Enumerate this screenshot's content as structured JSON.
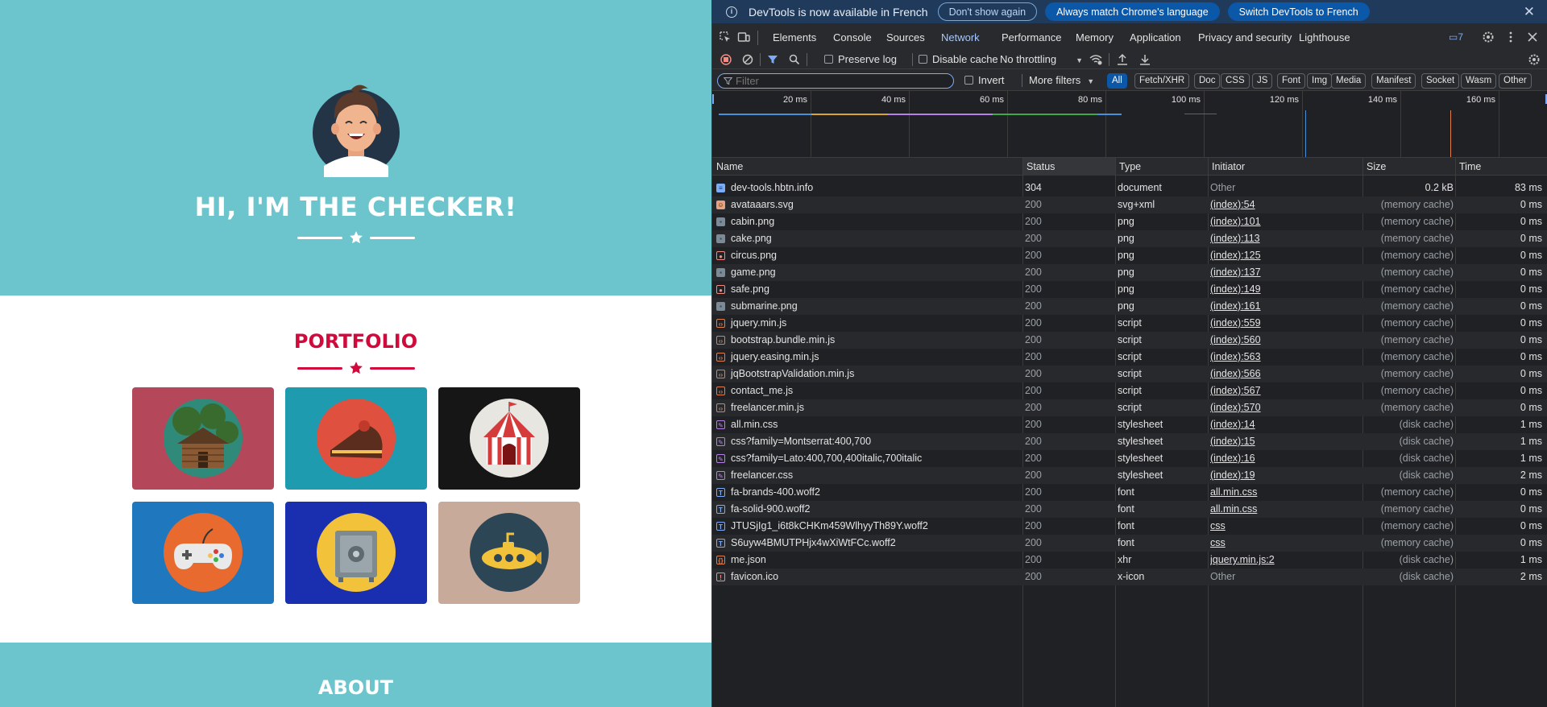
{
  "site": {
    "hero_title": "HI, I'M THE CHECKER!",
    "portfolio_title": "PORTFOLIO",
    "about_title": "ABOUT",
    "colors": {
      "primary": "#6cc5cc",
      "accent": "#d10a3c"
    },
    "portfolio_items": [
      {
        "name": "cabin",
        "bg": "#b5475b"
      },
      {
        "name": "cake",
        "bg": "#1f9bb0"
      },
      {
        "name": "circus",
        "bg": "#161616"
      },
      {
        "name": "game",
        "bg": "#1f77bd"
      },
      {
        "name": "safe",
        "bg": "#1a2fb0"
      },
      {
        "name": "submarine",
        "bg": "#c8aa9b"
      }
    ]
  },
  "devtools": {
    "infobar": {
      "text": "DevTools is now available in French",
      "dont_show": "Don't show again",
      "match_lang": "Always match Chrome's language",
      "switch_lang": "Switch DevTools to French",
      "close": "✕"
    },
    "tabs": [
      "Elements",
      "Console",
      "Sources",
      "Network",
      "Performance",
      "Memory",
      "Application",
      "Privacy and security",
      "Lighthouse"
    ],
    "active_tab": "Network",
    "issues_count": "7",
    "toolbar": {
      "preserve_log": "Preserve log",
      "disable_cache": "Disable cache",
      "throttling": "No throttling"
    },
    "filterbar": {
      "placeholder": "Filter",
      "invert": "Invert",
      "more_filters": "More filters",
      "chips": [
        "All",
        "Fetch/XHR",
        "Doc",
        "CSS",
        "JS",
        "Font",
        "Img",
        "Media",
        "Manifest",
        "Socket",
        "Wasm",
        "Other"
      ]
    },
    "timeline_ticks": [
      "20 ms",
      "40 ms",
      "60 ms",
      "80 ms",
      "100 ms",
      "120 ms",
      "140 ms",
      "160 ms"
    ],
    "columns": [
      "Name",
      "Status",
      "Type",
      "Initiator",
      "Size",
      "Time"
    ],
    "requests": [
      {
        "name": "dev-tools.hbtn.info",
        "status": "304",
        "type": "document",
        "initiator": "Other",
        "size": "0.2 kB",
        "time": "83 ms",
        "kind": "doc"
      },
      {
        "name": "avataaars.svg",
        "status": "200",
        "type": "svg+xml",
        "initiator": "(index):54",
        "size": "(memory cache)",
        "time": "0 ms",
        "kind": "img-face"
      },
      {
        "name": "cabin.png",
        "status": "200",
        "type": "png",
        "initiator": "(index):101",
        "size": "(memory cache)",
        "time": "0 ms",
        "kind": "img"
      },
      {
        "name": "cake.png",
        "status": "200",
        "type": "png",
        "initiator": "(index):113",
        "size": "(memory cache)",
        "time": "0 ms",
        "kind": "img"
      },
      {
        "name": "circus.png",
        "status": "200",
        "type": "png",
        "initiator": "(index):125",
        "size": "(memory cache)",
        "time": "0 ms",
        "kind": "img-dot"
      },
      {
        "name": "game.png",
        "status": "200",
        "type": "png",
        "initiator": "(index):137",
        "size": "(memory cache)",
        "time": "0 ms",
        "kind": "img"
      },
      {
        "name": "safe.png",
        "status": "200",
        "type": "png",
        "initiator": "(index):149",
        "size": "(memory cache)",
        "time": "0 ms",
        "kind": "img-dot"
      },
      {
        "name": "submarine.png",
        "status": "200",
        "type": "png",
        "initiator": "(index):161",
        "size": "(memory cache)",
        "time": "0 ms",
        "kind": "img"
      },
      {
        "name": "jquery.min.js",
        "status": "200",
        "type": "script",
        "initiator": "(index):559",
        "size": "(memory cache)",
        "time": "0 ms",
        "kind": "js"
      },
      {
        "name": "bootstrap.bundle.min.js",
        "status": "200",
        "type": "script",
        "initiator": "(index):560",
        "size": "(memory cache)",
        "time": "0 ms",
        "kind": "js"
      },
      {
        "name": "jquery.easing.min.js",
        "status": "200",
        "type": "script",
        "initiator": "(index):563",
        "size": "(memory cache)",
        "time": "0 ms",
        "kind": "js"
      },
      {
        "name": "jqBootstrapValidation.min.js",
        "status": "200",
        "type": "script",
        "initiator": "(index):566",
        "size": "(memory cache)",
        "time": "0 ms",
        "kind": "js"
      },
      {
        "name": "contact_me.js",
        "status": "200",
        "type": "script",
        "initiator": "(index):567",
        "size": "(memory cache)",
        "time": "0 ms",
        "kind": "js"
      },
      {
        "name": "freelancer.min.js",
        "status": "200",
        "type": "script",
        "initiator": "(index):570",
        "size": "(memory cache)",
        "time": "0 ms",
        "kind": "js"
      },
      {
        "name": "all.min.css",
        "status": "200",
        "type": "stylesheet",
        "initiator": "(index):14",
        "size": "(disk cache)",
        "time": "1 ms",
        "kind": "css"
      },
      {
        "name": "css?family=Montserrat:400,700",
        "status": "200",
        "type": "stylesheet",
        "initiator": "(index):15",
        "size": "(disk cache)",
        "time": "1 ms",
        "kind": "css"
      },
      {
        "name": "css?family=Lato:400,700,400italic,700italic",
        "status": "200",
        "type": "stylesheet",
        "initiator": "(index):16",
        "size": "(disk cache)",
        "time": "1 ms",
        "kind": "css"
      },
      {
        "name": "freelancer.css",
        "status": "200",
        "type": "stylesheet",
        "initiator": "(index):19",
        "size": "(disk cache)",
        "time": "2 ms",
        "kind": "css"
      },
      {
        "name": "fa-brands-400.woff2",
        "status": "200",
        "type": "font",
        "initiator": "all.min.css",
        "size": "(memory cache)",
        "time": "0 ms",
        "kind": "font"
      },
      {
        "name": "fa-solid-900.woff2",
        "status": "200",
        "type": "font",
        "initiator": "all.min.css",
        "size": "(memory cache)",
        "time": "0 ms",
        "kind": "font"
      },
      {
        "name": "JTUSjIg1_i6t8kCHKm459WlhyyTh89Y.woff2",
        "status": "200",
        "type": "font",
        "initiator": "css",
        "size": "(memory cache)",
        "time": "0 ms",
        "kind": "font"
      },
      {
        "name": "S6uyw4BMUTPHjx4wXiWtFCc.woff2",
        "status": "200",
        "type": "font",
        "initiator": "css",
        "size": "(memory cache)",
        "time": "0 ms",
        "kind": "font"
      },
      {
        "name": "me.json",
        "status": "200",
        "type": "xhr",
        "initiator": "jquery.min.js:2",
        "size": "(disk cache)",
        "time": "1 ms",
        "kind": "xhr"
      },
      {
        "name": "favicon.ico",
        "status": "200",
        "type": "x-icon",
        "initiator": "Other",
        "size": "(disk cache)",
        "time": "2 ms",
        "kind": "ico"
      }
    ]
  }
}
